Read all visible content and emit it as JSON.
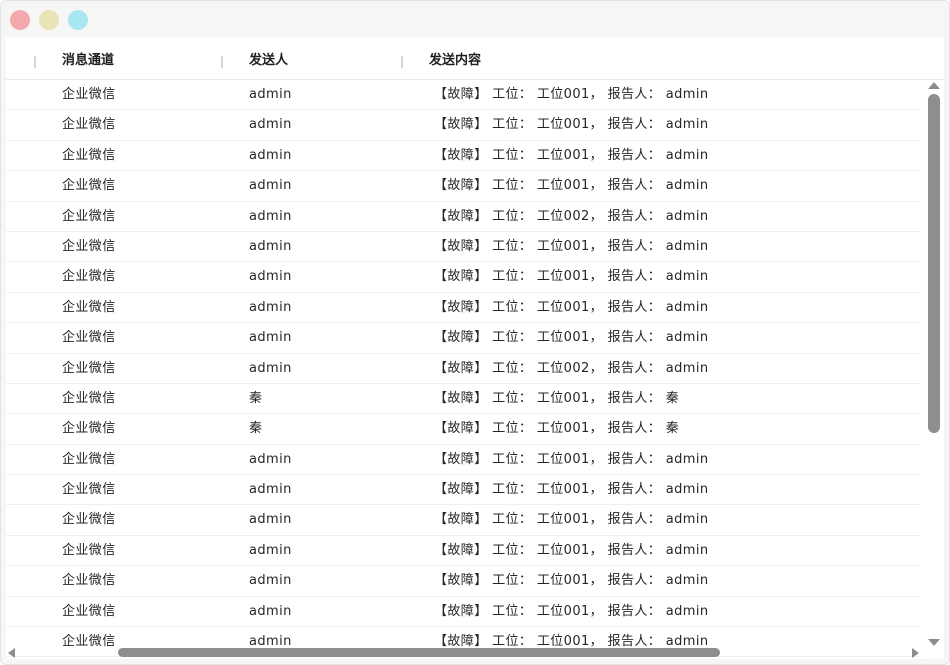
{
  "table": {
    "headers": [
      "消息通道",
      "发送人",
      "发送内容"
    ],
    "rows": [
      [
        "企业微信",
        "admin",
        "【故障】 工位： 工位001， 报告人： admin"
      ],
      [
        "企业微信",
        "admin",
        "【故障】 工位： 工位001， 报告人： admin"
      ],
      [
        "企业微信",
        "admin",
        "【故障】 工位： 工位001， 报告人： admin"
      ],
      [
        "企业微信",
        "admin",
        "【故障】 工位： 工位001， 报告人： admin"
      ],
      [
        "企业微信",
        "admin",
        "【故障】 工位： 工位002， 报告人： admin"
      ],
      [
        "企业微信",
        "admin",
        "【故障】 工位： 工位001， 报告人： admin"
      ],
      [
        "企业微信",
        "admin",
        "【故障】 工位： 工位001， 报告人： admin"
      ],
      [
        "企业微信",
        "admin",
        "【故障】 工位： 工位001， 报告人： admin"
      ],
      [
        "企业微信",
        "admin",
        "【故障】 工位： 工位001， 报告人： admin"
      ],
      [
        "企业微信",
        "admin",
        "【故障】 工位： 工位002， 报告人： admin"
      ],
      [
        "企业微信",
        "秦",
        "【故障】 工位： 工位001， 报告人： 秦"
      ],
      [
        "企业微信",
        "秦",
        "【故障】 工位： 工位001， 报告人： 秦"
      ],
      [
        "企业微信",
        "admin",
        "【故障】 工位： 工位001， 报告人： admin"
      ],
      [
        "企业微信",
        "admin",
        "【故障】 工位： 工位001， 报告人： admin"
      ],
      [
        "企业微信",
        "admin",
        "【故障】 工位： 工位001， 报告人： admin"
      ],
      [
        "企业微信",
        "admin",
        "【故障】 工位： 工位001， 报告人： admin"
      ],
      [
        "企业微信",
        "admin",
        "【故障】 工位： 工位001， 报告人： admin"
      ],
      [
        "企业微信",
        "admin",
        "【故障】 工位： 工位001， 报告人： admin"
      ],
      [
        "企业微信",
        "admin",
        "【故障】 工位： 工位001， 报告人： admin"
      ]
    ]
  },
  "colors": {
    "close": "#f4a9ad",
    "minimize": "#e8e4b6",
    "maximize": "#a6e7f0",
    "scroll_thumb": "#8e8e8e"
  }
}
